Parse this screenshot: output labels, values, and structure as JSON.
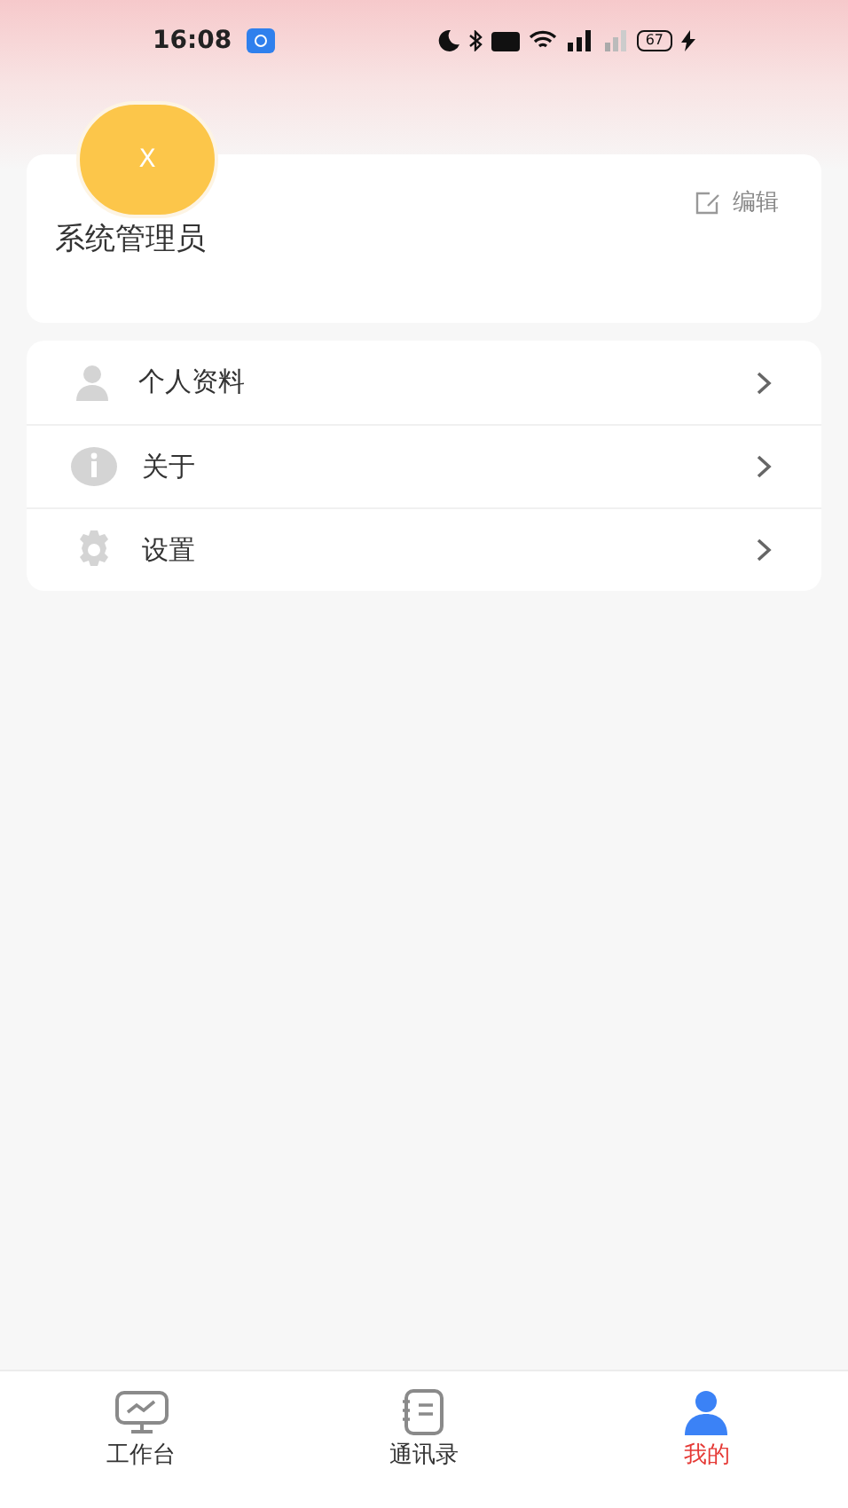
{
  "status_bar": {
    "time": "16:08",
    "battery": "67"
  },
  "profile": {
    "avatar_letter": "X",
    "name": "系统管理员",
    "edit_label": "编辑"
  },
  "menu": [
    {
      "kind": "profile",
      "label": "个人资料"
    },
    {
      "kind": "about",
      "label": "关于"
    },
    {
      "kind": "settings",
      "label": "设置"
    }
  ],
  "tabs": [
    {
      "kind": "workbench",
      "label": "工作台",
      "selected": false
    },
    {
      "kind": "contacts",
      "label": "通讯录",
      "selected": false
    },
    {
      "kind": "me",
      "label": "我的",
      "selected": true
    }
  ]
}
